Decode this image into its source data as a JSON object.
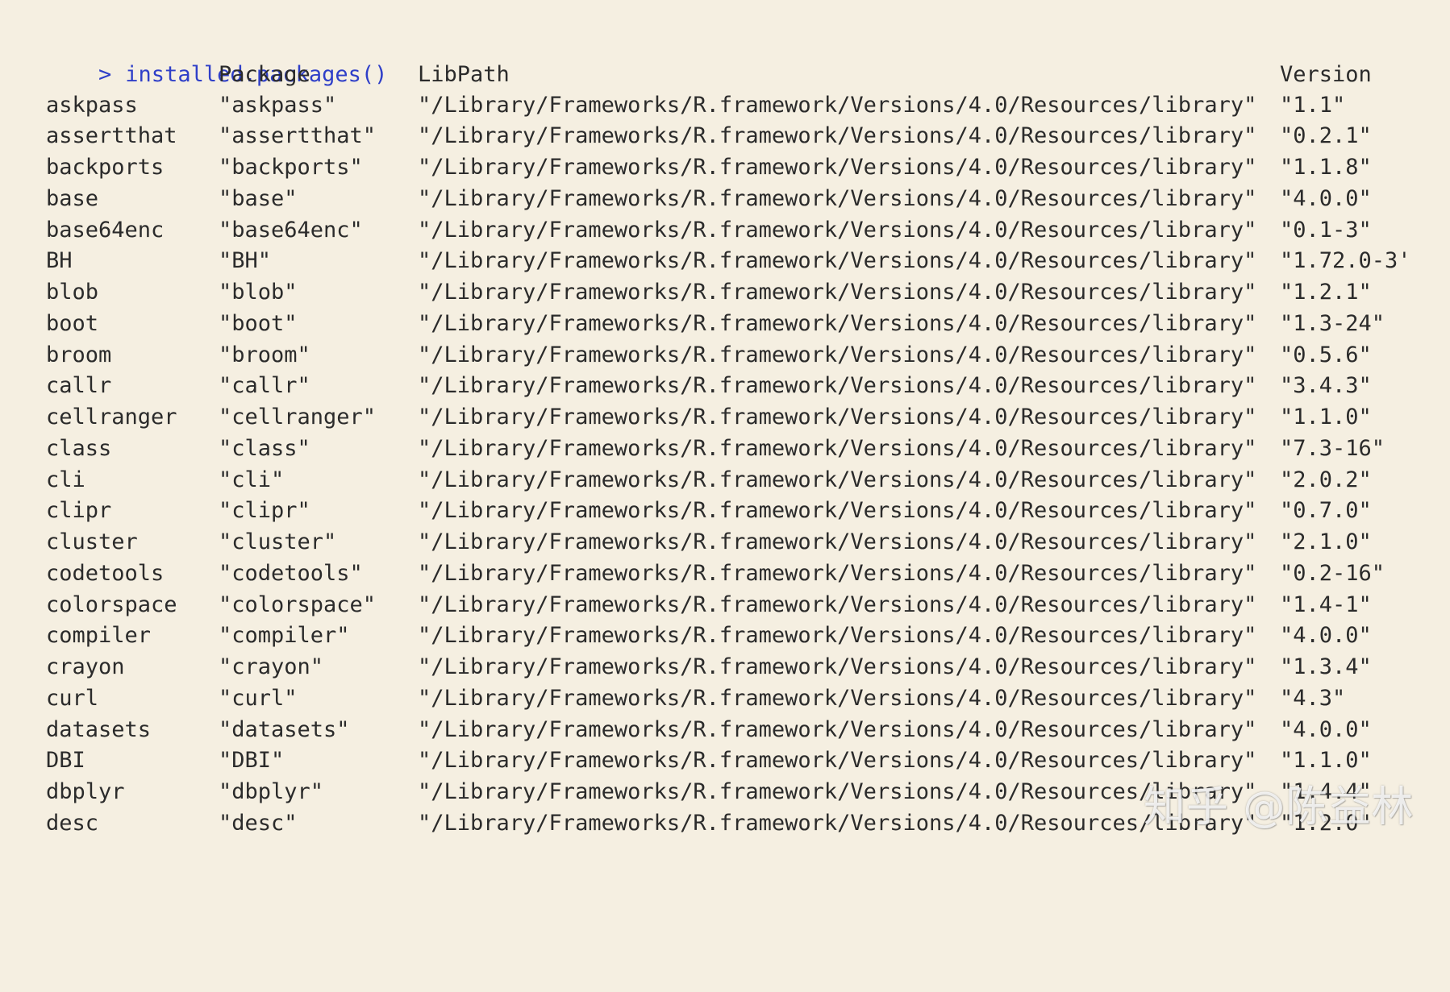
{
  "console": {
    "prompt_symbol": ">",
    "command": "installed.packages()"
  },
  "table": {
    "headers": [
      "",
      "Package",
      "LibPath",
      "Version"
    ],
    "rows": [
      {
        "name": "askpass",
        "package": "\"askpass\"",
        "libpath": "\"/Library/Frameworks/R.framework/Versions/4.0/Resources/library\"",
        "version": "\"1.1\""
      },
      {
        "name": "assertthat",
        "package": "\"assertthat\"",
        "libpath": "\"/Library/Frameworks/R.framework/Versions/4.0/Resources/library\"",
        "version": "\"0.2.1\""
      },
      {
        "name": "backports",
        "package": "\"backports\"",
        "libpath": "\"/Library/Frameworks/R.framework/Versions/4.0/Resources/library\"",
        "version": "\"1.1.8\""
      },
      {
        "name": "base",
        "package": "\"base\"",
        "libpath": "\"/Library/Frameworks/R.framework/Versions/4.0/Resources/library\"",
        "version": "\"4.0.0\""
      },
      {
        "name": "base64enc",
        "package": "\"base64enc\"",
        "libpath": "\"/Library/Frameworks/R.framework/Versions/4.0/Resources/library\"",
        "version": "\"0.1-3\""
      },
      {
        "name": "BH",
        "package": "\"BH\"",
        "libpath": "\"/Library/Frameworks/R.framework/Versions/4.0/Resources/library\"",
        "version": "\"1.72.0-3'"
      },
      {
        "name": "blob",
        "package": "\"blob\"",
        "libpath": "\"/Library/Frameworks/R.framework/Versions/4.0/Resources/library\"",
        "version": "\"1.2.1\""
      },
      {
        "name": "boot",
        "package": "\"boot\"",
        "libpath": "\"/Library/Frameworks/R.framework/Versions/4.0/Resources/library\"",
        "version": "\"1.3-24\""
      },
      {
        "name": "broom",
        "package": "\"broom\"",
        "libpath": "\"/Library/Frameworks/R.framework/Versions/4.0/Resources/library\"",
        "version": "\"0.5.6\""
      },
      {
        "name": "callr",
        "package": "\"callr\"",
        "libpath": "\"/Library/Frameworks/R.framework/Versions/4.0/Resources/library\"",
        "version": "\"3.4.3\""
      },
      {
        "name": "cellranger",
        "package": "\"cellranger\"",
        "libpath": "\"/Library/Frameworks/R.framework/Versions/4.0/Resources/library\"",
        "version": "\"1.1.0\""
      },
      {
        "name": "class",
        "package": "\"class\"",
        "libpath": "\"/Library/Frameworks/R.framework/Versions/4.0/Resources/library\"",
        "version": "\"7.3-16\""
      },
      {
        "name": "cli",
        "package": "\"cli\"",
        "libpath": "\"/Library/Frameworks/R.framework/Versions/4.0/Resources/library\"",
        "version": "\"2.0.2\""
      },
      {
        "name": "clipr",
        "package": "\"clipr\"",
        "libpath": "\"/Library/Frameworks/R.framework/Versions/4.0/Resources/library\"",
        "version": "\"0.7.0\""
      },
      {
        "name": "cluster",
        "package": "\"cluster\"",
        "libpath": "\"/Library/Frameworks/R.framework/Versions/4.0/Resources/library\"",
        "version": "\"2.1.0\""
      },
      {
        "name": "codetools",
        "package": "\"codetools\"",
        "libpath": "\"/Library/Frameworks/R.framework/Versions/4.0/Resources/library\"",
        "version": "\"0.2-16\""
      },
      {
        "name": "colorspace",
        "package": "\"colorspace\"",
        "libpath": "\"/Library/Frameworks/R.framework/Versions/4.0/Resources/library\"",
        "version": "\"1.4-1\""
      },
      {
        "name": "compiler",
        "package": "\"compiler\"",
        "libpath": "\"/Library/Frameworks/R.framework/Versions/4.0/Resources/library\"",
        "version": "\"4.0.0\""
      },
      {
        "name": "crayon",
        "package": "\"crayon\"",
        "libpath": "\"/Library/Frameworks/R.framework/Versions/4.0/Resources/library\"",
        "version": "\"1.3.4\""
      },
      {
        "name": "curl",
        "package": "\"curl\"",
        "libpath": "\"/Library/Frameworks/R.framework/Versions/4.0/Resources/library\"",
        "version": "\"4.3\""
      },
      {
        "name": "datasets",
        "package": "\"datasets\"",
        "libpath": "\"/Library/Frameworks/R.framework/Versions/4.0/Resources/library\"",
        "version": "\"4.0.0\""
      },
      {
        "name": "DBI",
        "package": "\"DBI\"",
        "libpath": "\"/Library/Frameworks/R.framework/Versions/4.0/Resources/library\"",
        "version": "\"1.1.0\""
      },
      {
        "name": "dbplyr",
        "package": "\"dbplyr\"",
        "libpath": "\"/Library/Frameworks/R.framework/Versions/4.0/Resources/library\"",
        "version": "\"1.4.4\""
      },
      {
        "name": "desc",
        "package": "\"desc\"",
        "libpath": "\"/Library/Frameworks/R.framework/Versions/4.0/Resources/library\"",
        "version": "\"1.2.0\""
      }
    ]
  },
  "watermark": {
    "text": "知乎 @陈益林"
  },
  "colors": {
    "background": "#f5efe1",
    "command": "#2f3fc8",
    "output_text": "#2b2b2b"
  }
}
